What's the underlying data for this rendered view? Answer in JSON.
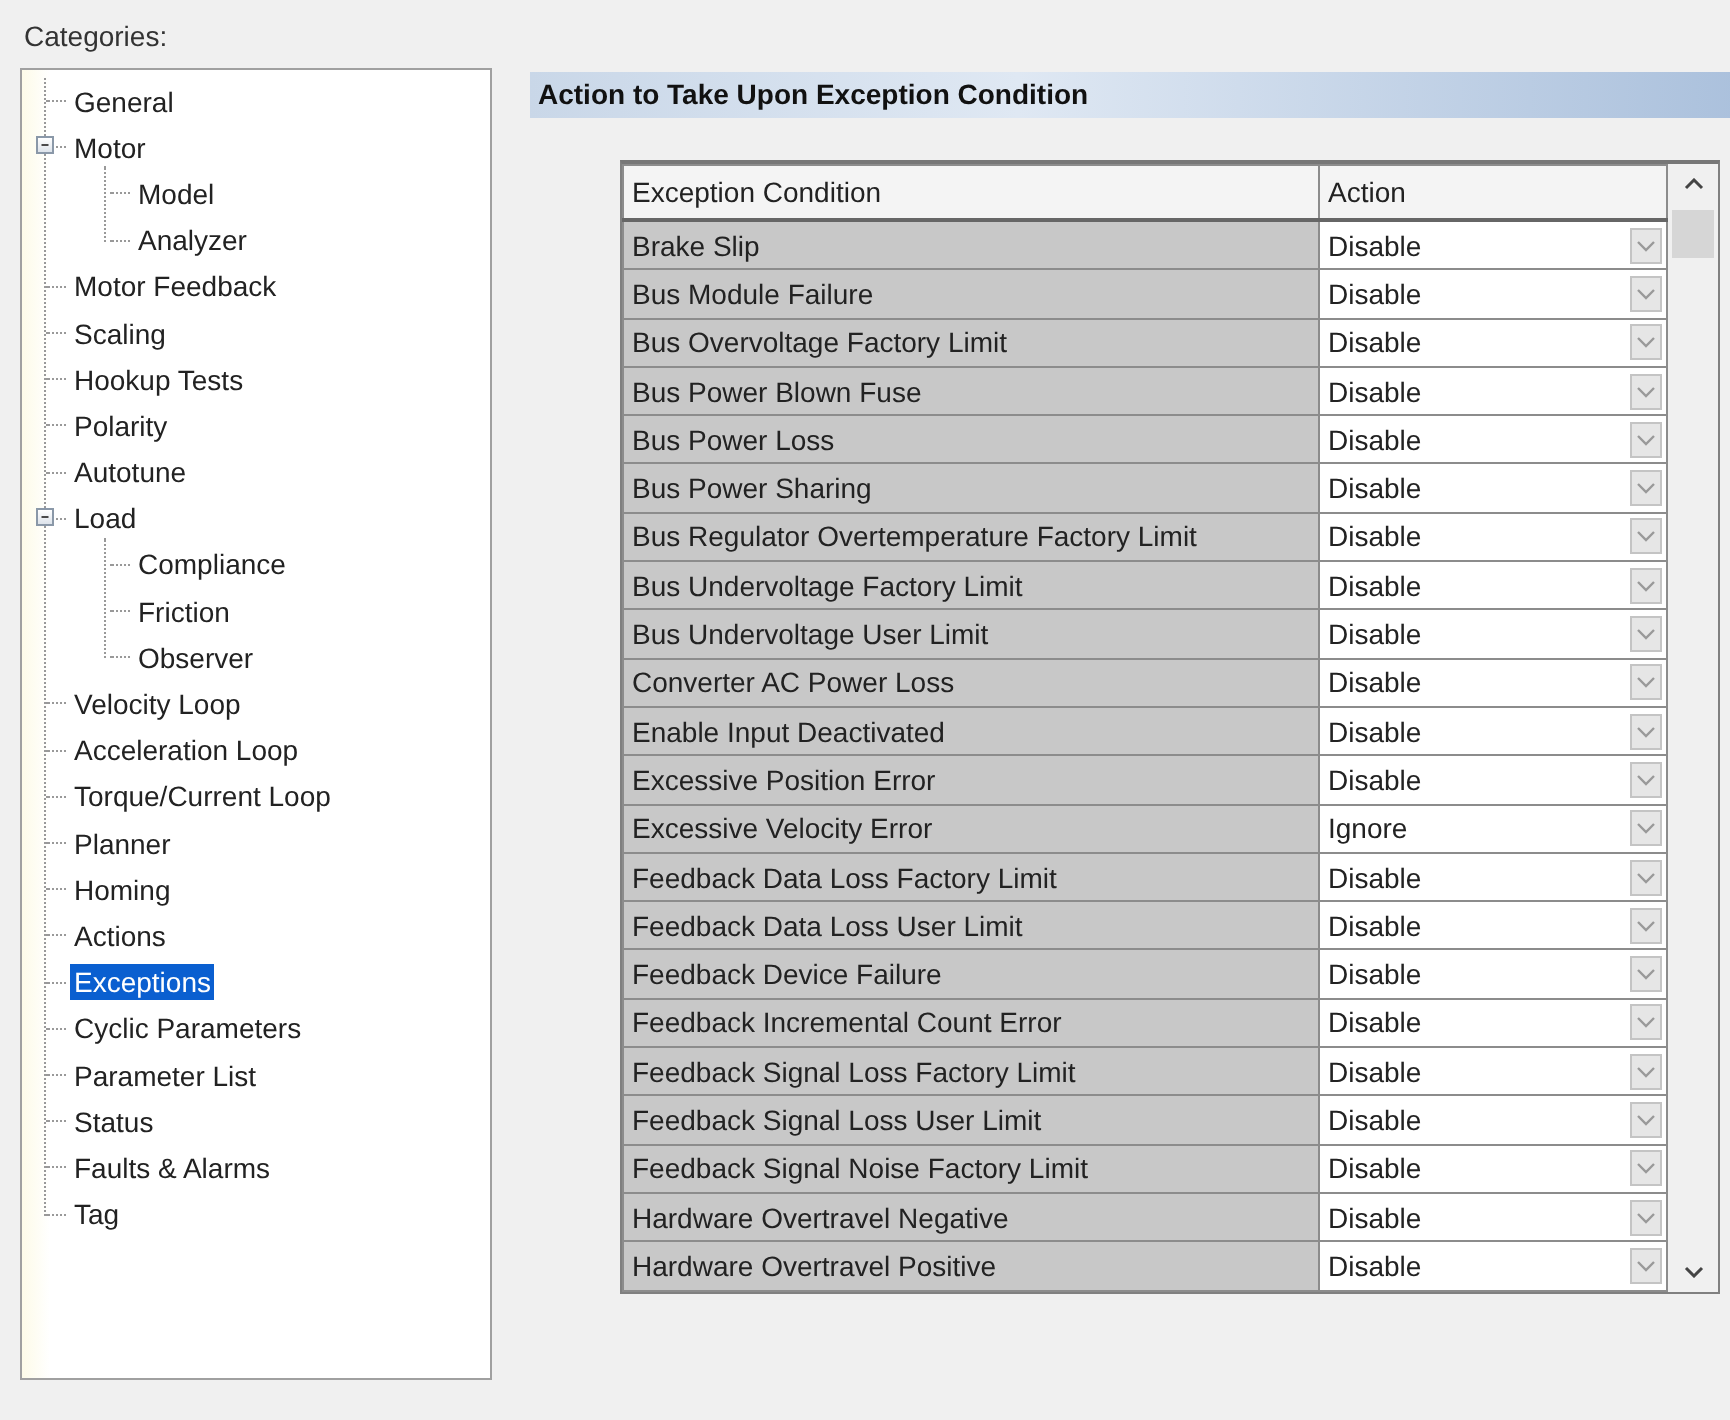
{
  "categories_label": "Categories:",
  "tree": [
    {
      "label": "General",
      "selected": false
    },
    {
      "label": "Motor",
      "selected": false,
      "expanded": true,
      "children": [
        {
          "label": "Model",
          "selected": false
        },
        {
          "label": "Analyzer",
          "selected": false
        }
      ]
    },
    {
      "label": "Motor Feedback",
      "selected": false
    },
    {
      "label": "Scaling",
      "selected": false
    },
    {
      "label": "Hookup Tests",
      "selected": false
    },
    {
      "label": "Polarity",
      "selected": false
    },
    {
      "label": "Autotune",
      "selected": false
    },
    {
      "label": "Load",
      "selected": false,
      "expanded": true,
      "children": [
        {
          "label": "Compliance",
          "selected": false
        },
        {
          "label": "Friction",
          "selected": false
        },
        {
          "label": "Observer",
          "selected": false
        }
      ]
    },
    {
      "label": "Velocity Loop",
      "selected": false
    },
    {
      "label": "Acceleration Loop",
      "selected": false
    },
    {
      "label": "Torque/Current Loop",
      "selected": false
    },
    {
      "label": "Planner",
      "selected": false
    },
    {
      "label": "Homing",
      "selected": false
    },
    {
      "label": "Actions",
      "selected": false
    },
    {
      "label": "Exceptions",
      "selected": true
    },
    {
      "label": "Cyclic Parameters",
      "selected": false
    },
    {
      "label": "Parameter List",
      "selected": false
    },
    {
      "label": "Status",
      "selected": false
    },
    {
      "label": "Faults & Alarms",
      "selected": false
    },
    {
      "label": "Tag",
      "selected": false
    }
  ],
  "section_title": "Action to Take Upon Exception Condition",
  "table": {
    "columns": [
      "Exception Condition",
      "Action"
    ],
    "rows": [
      [
        "Brake Slip",
        "Disable"
      ],
      [
        "Bus Module Failure",
        "Disable"
      ],
      [
        "Bus Overvoltage Factory Limit",
        "Disable"
      ],
      [
        "Bus Power Blown Fuse",
        "Disable"
      ],
      [
        "Bus Power Loss",
        "Disable"
      ],
      [
        "Bus Power Sharing",
        "Disable"
      ],
      [
        "Bus Regulator Overtemperature Factory Limit",
        "Disable"
      ],
      [
        "Bus Undervoltage Factory Limit",
        "Disable"
      ],
      [
        "Bus Undervoltage User Limit",
        "Disable"
      ],
      [
        "Converter AC Power Loss",
        "Disable"
      ],
      [
        "Enable Input Deactivated",
        "Disable"
      ],
      [
        "Excessive Position Error",
        "Disable"
      ],
      [
        "Excessive Velocity Error",
        "Ignore"
      ],
      [
        "Feedback Data Loss Factory Limit",
        "Disable"
      ],
      [
        "Feedback Data Loss User Limit",
        "Disable"
      ],
      [
        "Feedback Device Failure",
        "Disable"
      ],
      [
        "Feedback Incremental Count Error",
        "Disable"
      ],
      [
        "Feedback Signal Loss Factory Limit",
        "Disable"
      ],
      [
        "Feedback Signal Loss User Limit",
        "Disable"
      ],
      [
        "Feedback Signal Noise Factory Limit",
        "Disable"
      ],
      [
        "Hardware Overtravel Negative",
        "Disable"
      ],
      [
        "Hardware Overtravel Positive",
        "Disable"
      ]
    ]
  }
}
